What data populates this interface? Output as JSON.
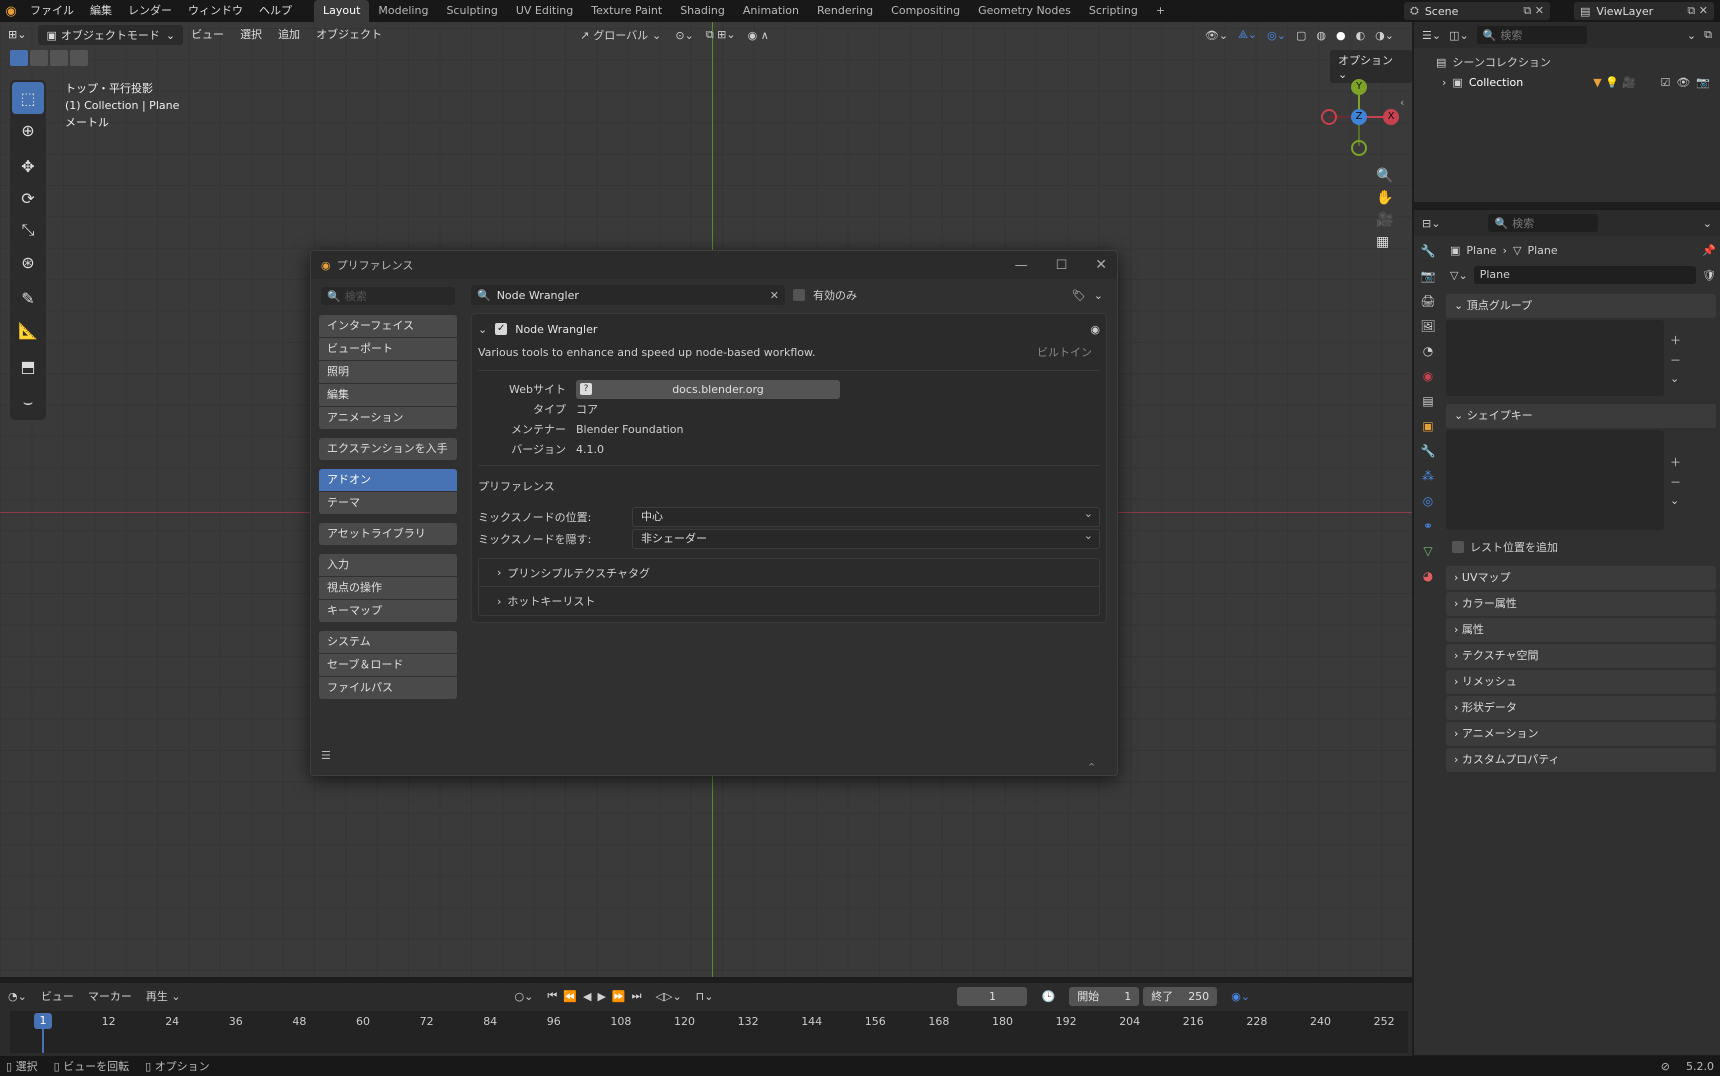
{
  "topbar": {
    "menus": [
      "ファイル",
      "編集",
      "レンダー",
      "ウィンドウ",
      "ヘルプ"
    ],
    "workspaces": [
      "Layout",
      "Modeling",
      "Sculpting",
      "UV Editing",
      "Texture Paint",
      "Shading",
      "Animation",
      "Rendering",
      "Compositing",
      "Geometry Nodes",
      "Scripting"
    ],
    "active_workspace": "Layout",
    "add_tab": "+",
    "scene": "Scene",
    "view_layer": "ViewLayer"
  },
  "viewport": {
    "mode": "オブジェクトモード",
    "menus": [
      "ビュー",
      "選択",
      "追加",
      "オブジェクト"
    ],
    "orientation": "グローバル",
    "options": "オプション",
    "overlay_lines": [
      "トップ・平行投影",
      "(1) Collection | Plane",
      "メートル"
    ],
    "gizmo": {
      "y": "Y",
      "z": "Z",
      "x": "X"
    }
  },
  "outliner": {
    "search_placeholder": "検索",
    "root": "シーンコレクション",
    "collection": "Collection"
  },
  "properties": {
    "search_placeholder": "検索",
    "breadcrumb_object": "Plane",
    "breadcrumb_data": "Plane",
    "mesh_name": "Plane",
    "vertex_groups": "頂点グループ",
    "shape_keys": "シェイプキー",
    "rest_position": "レスト位置を追加",
    "panels": [
      "UVマップ",
      "カラー属性",
      "属性",
      "テクスチャ空間",
      "リメッシュ",
      "形状データ",
      "アニメーション",
      "カスタムプロパティ"
    ]
  },
  "dialog": {
    "title": "プリファレンス",
    "search_placeholder": "検索",
    "categories": [
      {
        "label": "インターフェイス",
        "group": 1
      },
      {
        "label": "ビューポート",
        "group": 1
      },
      {
        "label": "照明",
        "group": 1
      },
      {
        "label": "編集",
        "group": 1
      },
      {
        "label": "アニメーション",
        "group": 1
      },
      {
        "label": "エクステンションを入手",
        "group": 2
      },
      {
        "label": "アドオン",
        "group": 3,
        "active": true
      },
      {
        "label": "テーマ",
        "group": 3
      },
      {
        "label": "アセットライブラリ",
        "group": 4
      },
      {
        "label": "入力",
        "group": 5
      },
      {
        "label": "視点の操作",
        "group": 5
      },
      {
        "label": "キーマップ",
        "group": 5
      },
      {
        "label": "システム",
        "group": 6
      },
      {
        "label": "セーブ＆ロード",
        "group": 6
      },
      {
        "label": "ファイルパス",
        "group": 6
      }
    ],
    "addon_search": "Node Wrangler",
    "enabled_only": "有効のみ",
    "addon": {
      "name": "Node Wrangler",
      "description": "Various tools to enhance and speed up node-based workflow.",
      "builtin": "ビルトイン",
      "website_label": "Webサイト",
      "website": "docs.blender.org",
      "type_label": "タイプ",
      "type": "コア",
      "maintainer_label": "メンテナー",
      "maintainer": "Blender Foundation",
      "version_label": "バージョン",
      "version": "4.1.0"
    },
    "prefs_title": "プリファレンス",
    "mix_pos_label": "ミックスノードの位置:",
    "mix_pos_value": "中心",
    "mix_hide_label": "ミックスノードを隠す:",
    "mix_hide_value": "非シェーダー",
    "sub_panels": [
      "プリンシプルテクスチャタグ",
      "ホットキーリスト"
    ]
  },
  "timeline": {
    "menus": [
      "ビュー",
      "マーカー"
    ],
    "playback": "再生",
    "current_frame": "1",
    "start_label": "開始",
    "start": "1",
    "end_label": "終了",
    "end": "250",
    "ticks": [
      "1",
      "12",
      "24",
      "36",
      "48",
      "60",
      "72",
      "84",
      "96",
      "108",
      "120",
      "132",
      "144",
      "156",
      "168",
      "180",
      "192",
      "204",
      "216",
      "228",
      "240",
      "252"
    ]
  },
  "statusbar": {
    "items": [
      "選択",
      "ビューを回転",
      "オプション"
    ],
    "version": "5.2.0"
  },
  "colors": {
    "accent": "#4772b3",
    "x_axis": "#c8414e",
    "y_axis": "#7ea427",
    "z_axis": "#3f83d6"
  }
}
